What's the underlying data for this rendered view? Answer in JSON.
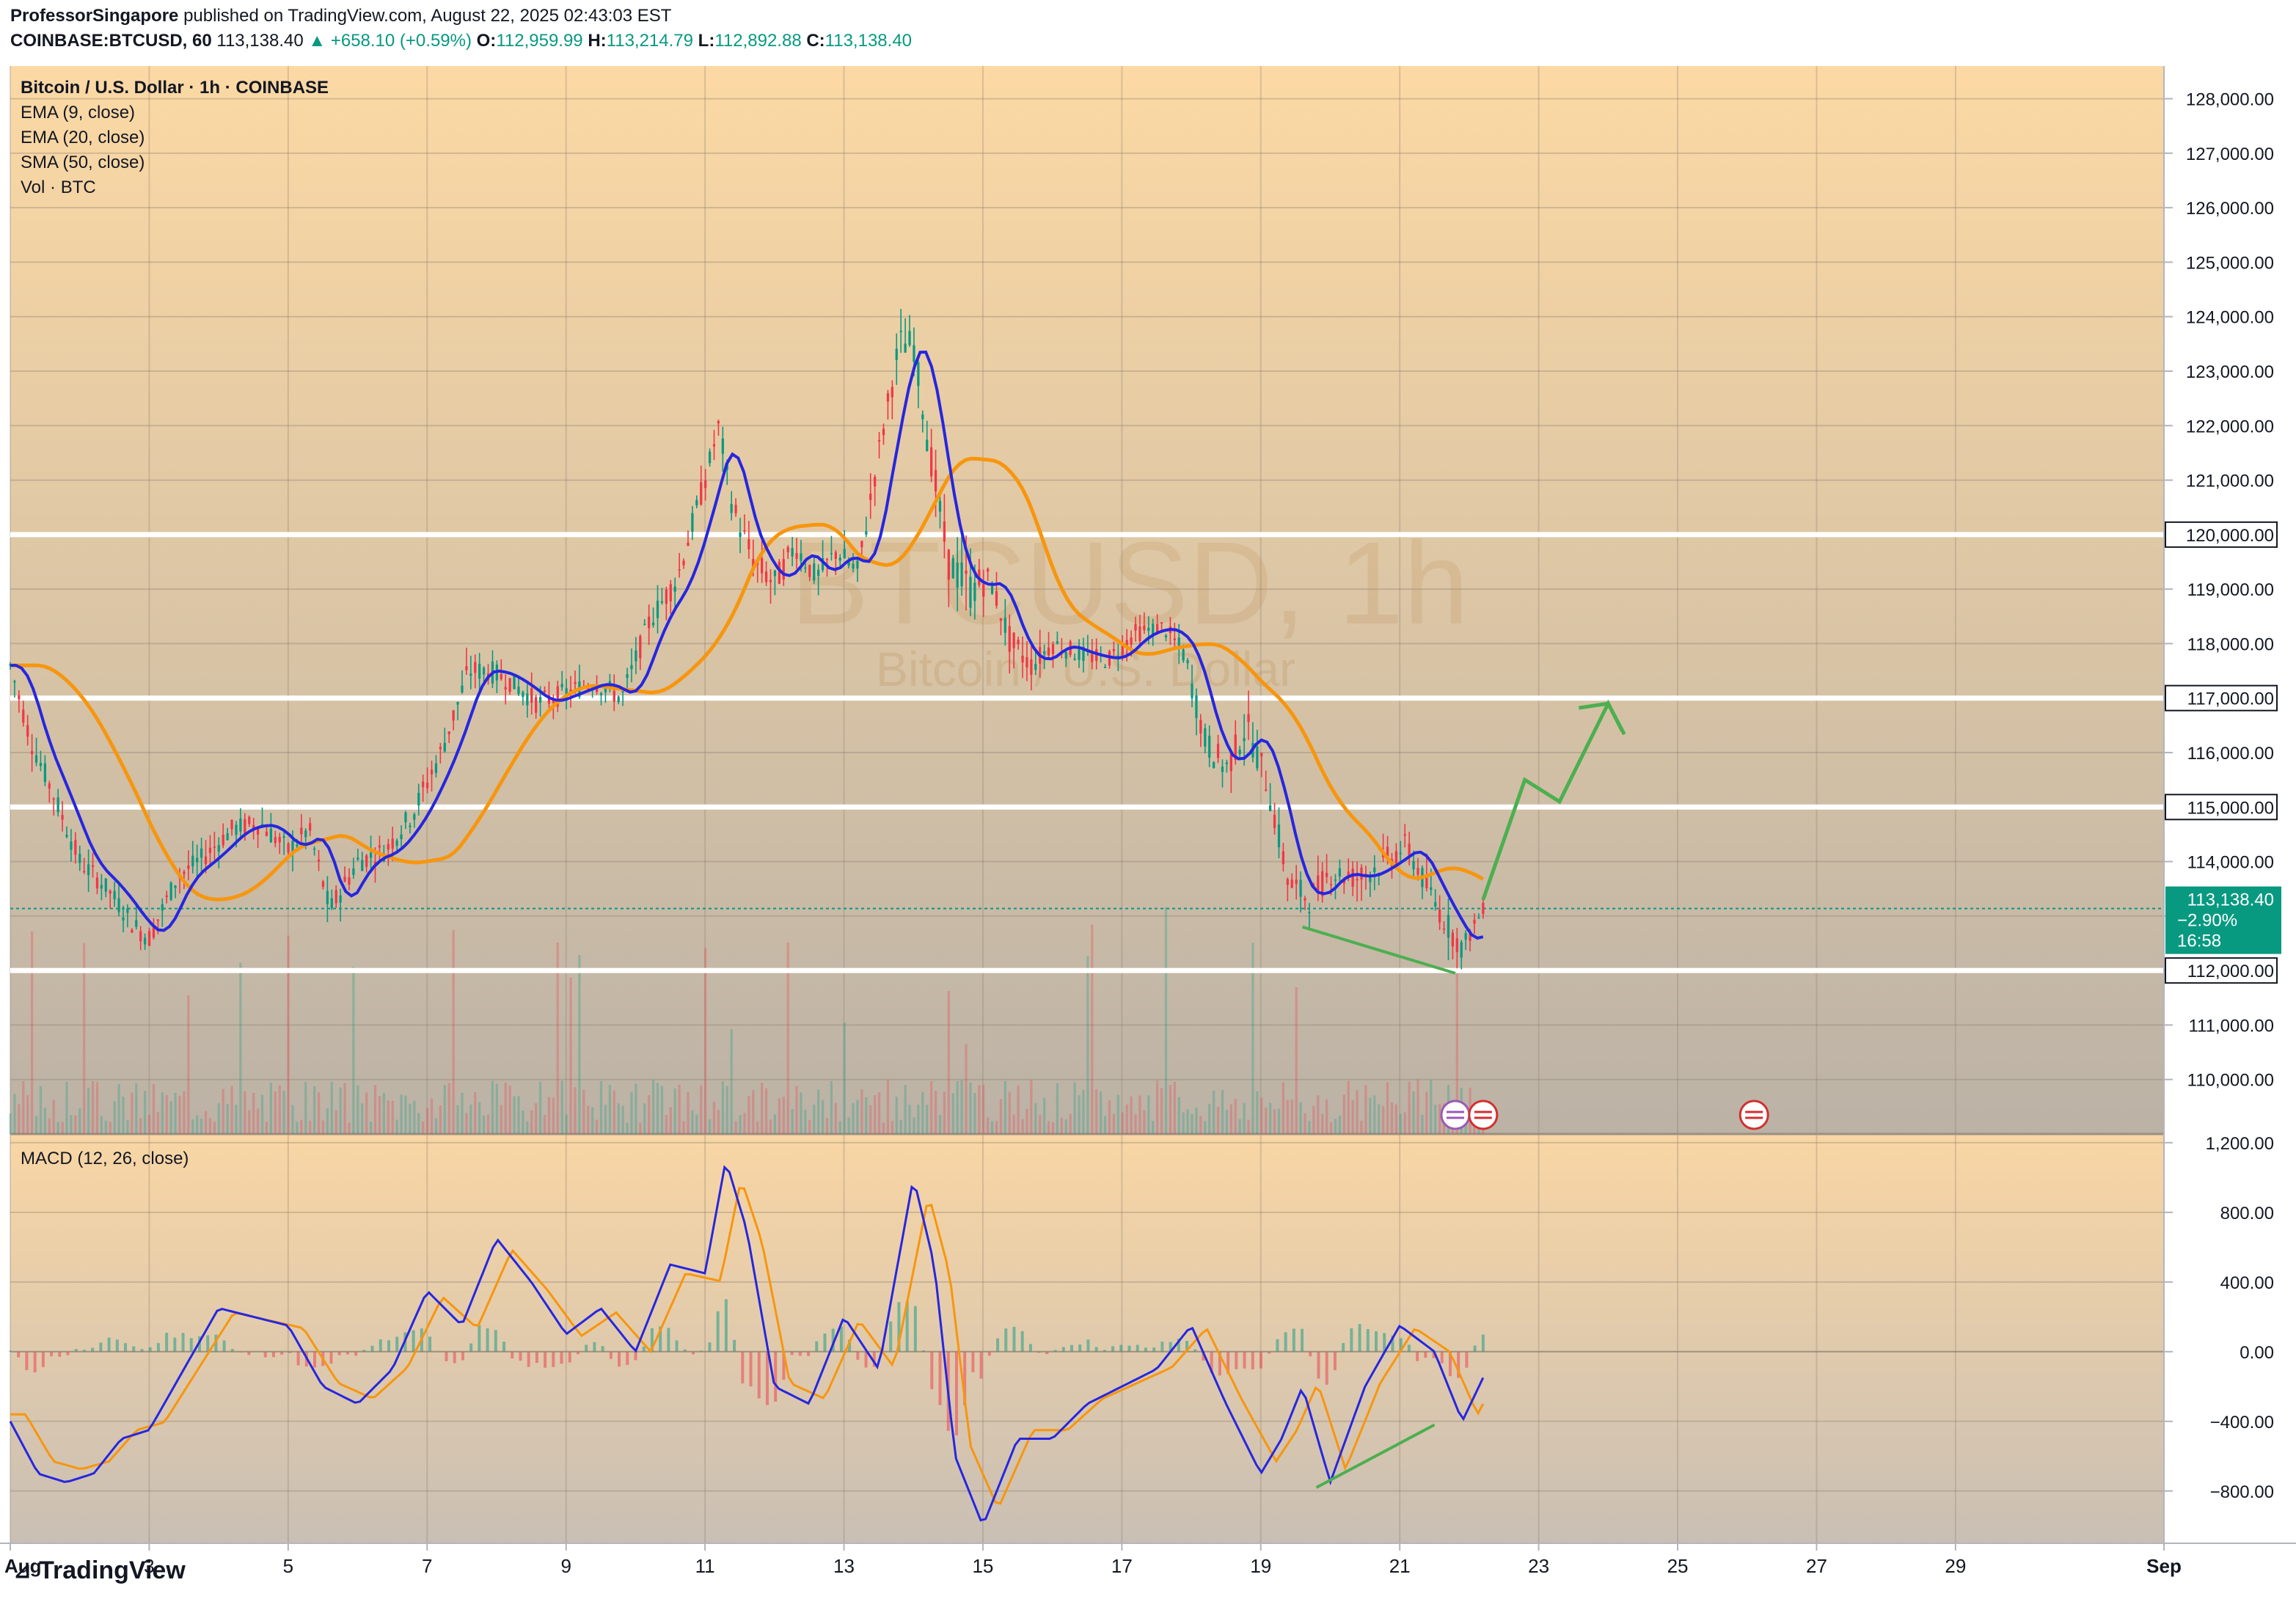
{
  "header": {
    "author": "ProfessorSingapore",
    "published_text": "published on TradingView.com, August 22, 2025 02:43:03 EST",
    "symbol": "COINBASE:BTCUSD, 60",
    "last_price": "113,138.40",
    "change_arrow": "▲",
    "change": "+658.10 (+0.59%)",
    "o_label": "O:",
    "o_value": "112,959.99",
    "h_label": "H:",
    "h_value": "113,214.79",
    "l_label": "L:",
    "l_value": "112,892.88",
    "c_label": "C:",
    "c_value": "113,138.40"
  },
  "legend": {
    "title": "Bitcoin / U.S. Dollar · 1h · COINBASE",
    "ema9": "EMA (9, close)",
    "ema20": "EMA (20, close)",
    "sma50": "SMA (50, close)",
    "vol": "Vol · BTC"
  },
  "watermark": {
    "big": "BTCUSD, 1h",
    "small": "Bitcoin / U.S. Dollar"
  },
  "macd_label": "MACD (12, 26, close)",
  "price_tag": {
    "price": "113,138.40",
    "change": "−2.90%",
    "countdown": "16:58"
  },
  "branding": {
    "logo_mark": "⊿",
    "logo_text": "TradingView"
  },
  "colors": {
    "ema9": "#2626e0",
    "sma50": "#f7960e",
    "up": "#089981",
    "down": "#f23645",
    "drawing": "#4caf50",
    "hline": "#ffffff",
    "price_tag": "#089981"
  },
  "chart_data": [
    {
      "type": "candlestick",
      "title": "Bitcoin / U.S. Dollar · 1h · COINBASE",
      "y_axis_ticks": [
        "128,000.00",
        "127,000.00",
        "126,000.00",
        "125,000.00",
        "124,000.00",
        "123,000.00",
        "122,000.00",
        "121,000.00",
        "120,000.00",
        "119,000.00",
        "118,000.00",
        "117,000.00",
        "116,000.00",
        "115,000.00",
        "114,000.00",
        "113,000.00",
        "112,000.00",
        "111,000.00",
        "110,000.00"
      ],
      "y_axis_tick_values": [
        128000,
        127000,
        126000,
        125000,
        124000,
        123000,
        122000,
        121000,
        120000,
        119000,
        118000,
        117000,
        116000,
        115000,
        114000,
        113000,
        112000,
        111000,
        110000
      ],
      "ylim": [
        109000,
        128600
      ],
      "x_axis_labels": [
        "Aug",
        "3",
        "5",
        "7",
        "9",
        "11",
        "13",
        "15",
        "17",
        "19",
        "21",
        "23",
        "25",
        "27",
        "29",
        "Sep"
      ],
      "x_axis_label_days": [
        1,
        3,
        5,
        7,
        9,
        11,
        13,
        15,
        17,
        19,
        21,
        23,
        25,
        27,
        29,
        32
      ],
      "x_range_days": [
        1.0,
        32.0
      ],
      "price_series": {
        "name": "BTCUSD",
        "day": [
          1.0,
          1.3,
          1.6,
          2.0,
          2.4,
          2.8,
          3.0,
          3.4,
          3.8,
          4.2,
          4.6,
          5.0,
          5.3,
          5.6,
          6.0,
          6.4,
          6.8,
          7.2,
          7.6,
          7.9,
          8.2,
          8.6,
          9.0,
          9.4,
          9.8,
          10.2,
          10.6,
          11.0,
          11.2,
          11.4,
          11.7,
          12.0,
          12.3,
          12.6,
          12.9,
          13.2,
          13.5,
          13.8,
          14.0,
          14.2,
          14.5,
          14.8,
          15.1,
          15.4,
          15.7,
          16.0,
          16.4,
          16.8,
          17.2,
          17.6,
          17.9,
          18.2,
          18.5,
          18.8,
          19.1,
          19.4,
          19.7,
          20.0,
          20.4,
          20.8,
          21.1,
          21.4,
          21.7,
          21.9,
          22.2
        ],
        "close": [
          117600,
          116200,
          115300,
          114000,
          113500,
          112800,
          112600,
          113700,
          114100,
          114600,
          114700,
          114200,
          114600,
          113100,
          114000,
          114200,
          114900,
          116000,
          117500,
          117500,
          117300,
          116900,
          117100,
          117300,
          117000,
          118400,
          119200,
          121000,
          122000,
          120500,
          119500,
          119100,
          119800,
          119200,
          119700,
          119300,
          121500,
          123500,
          123500,
          121800,
          119500,
          119000,
          119200,
          118000,
          117600,
          118000,
          117800,
          117700,
          118200,
          118300,
          117800,
          116200,
          115700,
          116500,
          115400,
          113600,
          113300,
          113800,
          113700,
          114000,
          114300,
          113500,
          112800,
          112400,
          113138
        ],
        "high": [
          118100,
          116800,
          115900,
          114600,
          113900,
          113300,
          113200,
          114200,
          114700,
          115200,
          115400,
          114800,
          115100,
          114000,
          114600,
          114800,
          115600,
          116700,
          118200,
          118100,
          117900,
          117500,
          117600,
          117900,
          117600,
          119000,
          119900,
          121600,
          122400,
          121300,
          120300,
          119800,
          120400,
          119800,
          120300,
          120000,
          122200,
          124600,
          124100,
          122800,
          120500,
          119700,
          119600,
          118700,
          118300,
          118500,
          118300,
          118200,
          118700,
          118700,
          118400,
          117000,
          116500,
          117300,
          116300,
          114500,
          114000,
          114500,
          114300,
          114800,
          114900,
          114200,
          113500,
          113000,
          113500
        ],
        "low": [
          117000,
          115600,
          114700,
          113400,
          112900,
          112100,
          112000,
          113100,
          113600,
          114100,
          114200,
          113600,
          114000,
          112700,
          113400,
          113700,
          114300,
          115400,
          116900,
          116900,
          116800,
          116300,
          116500,
          116800,
          116400,
          117800,
          118500,
          120300,
          121300,
          119800,
          118800,
          118300,
          119100,
          118500,
          119100,
          118600,
          120800,
          122800,
          122600,
          121000,
          118600,
          117100,
          118400,
          117100,
          117000,
          117400,
          117300,
          117200,
          117700,
          117800,
          117100,
          115400,
          114900,
          115600,
          114700,
          112900,
          112600,
          113100,
          112900,
          113300,
          113600,
          112800,
          112000,
          111800,
          112900
        ]
      },
      "overlays": [
        {
          "name": "EMA (9, close)",
          "color": "#2626e0"
        },
        {
          "name": "SMA (50, close)",
          "color": "#f7960e"
        }
      ],
      "horizontal_lines": [
        120000,
        117000,
        115000,
        112000
      ],
      "horizontal_line_labels": [
        "120,000.00",
        "117,000.00",
        "115,000.00",
        "112,000.00"
      ],
      "last_price": 113138.4,
      "volume": {
        "name": "Vol · BTC"
      },
      "drawings": {
        "divergence_support": [
          [
            19.6,
            112800
          ],
          [
            21.8,
            111950
          ]
        ],
        "projection_path": [
          [
            22.2,
            113300
          ],
          [
            22.8,
            115500
          ],
          [
            23.3,
            115100
          ],
          [
            24.0,
            116900
          ],
          [
            24.2,
            116400
          ]
        ]
      }
    },
    {
      "type": "line",
      "title": "MACD (12, 26, close)",
      "y_axis_ticks": [
        "1,200.00",
        "800.00",
        "400.00",
        "0.00",
        "−400.00",
        "−800.00"
      ],
      "y_axis_tick_values": [
        1200,
        800,
        400,
        0,
        -400,
        -800
      ],
      "ylim": [
        -1100,
        1250
      ],
      "series": [
        {
          "name": "MACD",
          "color": "#2626e0",
          "day": [
            1.0,
            1.4,
            1.8,
            2.2,
            2.6,
            3.0,
            3.5,
            4.0,
            4.5,
            5.0,
            5.5,
            6.0,
            6.5,
            7.0,
            7.5,
            8.0,
            8.5,
            9.0,
            9.5,
            10.0,
            10.5,
            11.0,
            11.3,
            11.6,
            12.0,
            12.5,
            13.0,
            13.5,
            14.0,
            14.3,
            14.6,
            15.0,
            15.5,
            16.0,
            16.5,
            17.0,
            17.5,
            18.0,
            18.5,
            19.0,
            19.3,
            19.6,
            20.0,
            20.5,
            21.0,
            21.5,
            21.9,
            22.2
          ],
          "value": [
            -400,
            -700,
            -750,
            -700,
            -500,
            -450,
            -100,
            250,
            200,
            150,
            -200,
            -300,
            -100,
            350,
            150,
            650,
            400,
            100,
            250,
            0,
            500,
            450,
            1100,
            700,
            -200,
            -300,
            200,
            -100,
            1000,
            500,
            -600,
            -1000,
            -500,
            -500,
            -300,
            -200,
            -100,
            150,
            -300,
            -700,
            -500,
            -200,
            -750,
            -200,
            150,
            0,
            -400,
            -150
          ]
        }
      ],
      "zero_line": 0,
      "drawings": {
        "divergence_line": [
          [
            19.8,
            -780
          ],
          [
            21.5,
            -420
          ]
        ]
      }
    }
  ]
}
